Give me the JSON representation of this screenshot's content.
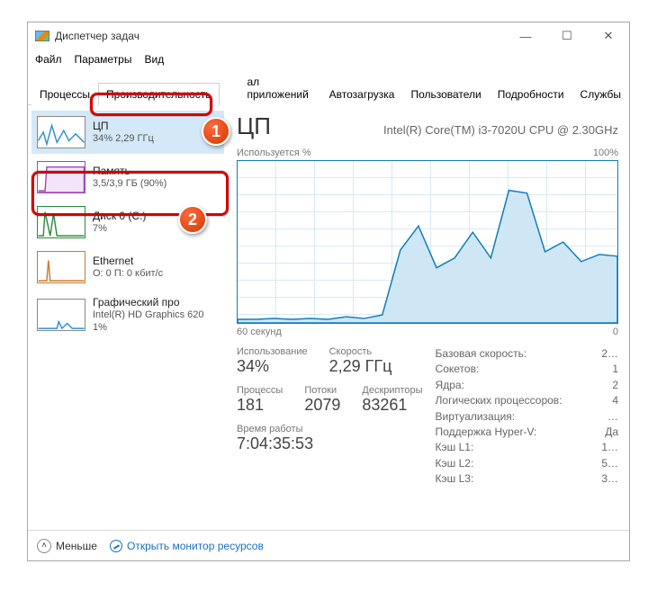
{
  "window": {
    "title": "Диспетчер задач"
  },
  "menu": {
    "file": "Файл",
    "options": "Параметры",
    "view": "Вид"
  },
  "tabs": {
    "processes": "Процессы",
    "performance": "Производительность",
    "app_history_tail": "ал приложений",
    "startup": "Автозагрузка",
    "users": "Пользователи",
    "details": "Подробности",
    "services": "Службы"
  },
  "sidebar": {
    "cpu": {
      "title": "ЦП",
      "sub": "34% 2,29 ГГц"
    },
    "mem": {
      "title": "Память",
      "sub": "3,5/3,9 ГБ (90%)"
    },
    "disk": {
      "title": "Диск 0 (C:)",
      "sub": "7%"
    },
    "eth": {
      "title": "Ethernet",
      "sub": "О: 0 П: 0 кбит/с"
    },
    "gpu": {
      "title": "Графический про",
      "sub": "Intel(R) HD Graphics 620",
      "sub2": "1%"
    }
  },
  "main": {
    "title": "ЦП",
    "device": "Intel(R) Core(TM) i3-7020U CPU @ 2.30GHz",
    "chart_top_left": "Используется %",
    "chart_top_right": "100%",
    "chart_bottom_left": "60 секунд",
    "chart_bottom_right": "0",
    "stats": {
      "usage_lbl": "Использование",
      "usage_val": "34%",
      "speed_lbl": "Скорость",
      "speed_val": "2,29 ГГц",
      "proc_lbl": "Процессы",
      "proc_val": "181",
      "threads_lbl": "Потоки",
      "threads_val": "2079",
      "handles_lbl": "Дескрипторы",
      "handles_val": "83261",
      "uptime_lbl": "Время работы",
      "uptime_val": "7:04:35:53"
    },
    "right": {
      "base_lbl": "Базовая скорость:",
      "base_val": "2…",
      "sockets_lbl": "Сокетов:",
      "sockets_val": "1",
      "cores_lbl": "Ядра:",
      "cores_val": "2",
      "logical_lbl": "Логических процессоров:",
      "logical_val": "4",
      "virt_lbl": "Виртуализация:",
      "virt_val": "…",
      "hyperv_lbl": "Поддержка Hyper-V:",
      "hyperv_val": "Да",
      "l1_lbl": "Кэш L1:",
      "l1_val": "1…",
      "l2_lbl": "Кэш L2:",
      "l2_val": "5…",
      "l3_lbl": "Кэш L3:",
      "l3_val": "3…"
    }
  },
  "footer": {
    "fewer": "Меньше",
    "link": "Открыть монитор ресурсов"
  },
  "chart_data": {
    "type": "line",
    "title": "Используется %",
    "xlabel": "60 секунд",
    "ylabel": "%",
    "ylim": [
      0,
      100
    ],
    "x_seconds": [
      60,
      57,
      54,
      51,
      48,
      45,
      42,
      39,
      36,
      33,
      30,
      27,
      24,
      21,
      18,
      15,
      12,
      9,
      6,
      3,
      0
    ],
    "values": [
      2,
      2,
      3,
      2,
      3,
      2,
      4,
      3,
      5,
      45,
      60,
      34,
      40,
      56,
      40,
      82,
      80,
      44,
      50,
      38,
      42
    ]
  }
}
